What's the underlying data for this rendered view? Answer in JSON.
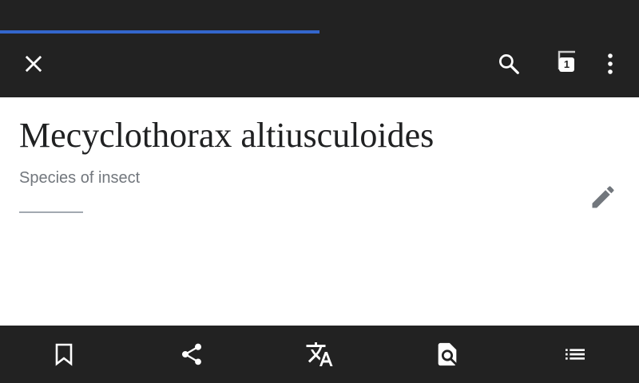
{
  "progress": {
    "fraction": 0.5,
    "color": "#3366cc"
  },
  "toolbar": {
    "close_icon": "close-icon",
    "search_icon": "search-icon",
    "tabs_icon": "tabs-icon",
    "tab_count": "1",
    "overflow_icon": "more-vert-icon"
  },
  "article": {
    "title": "Mecyclothorax altiusculoides",
    "description": "Species of insect",
    "edit_icon": "pencil-icon"
  },
  "bottom_bar": {
    "items": [
      {
        "icon": "bookmark-icon"
      },
      {
        "icon": "share-icon"
      },
      {
        "icon": "translate-icon"
      },
      {
        "icon": "find-in-page-icon"
      },
      {
        "icon": "contents-list-icon"
      }
    ]
  },
  "colors": {
    "bar_background": "#222222",
    "accent": "#3366cc",
    "title_text": "#202122",
    "description_text": "#72777d"
  }
}
